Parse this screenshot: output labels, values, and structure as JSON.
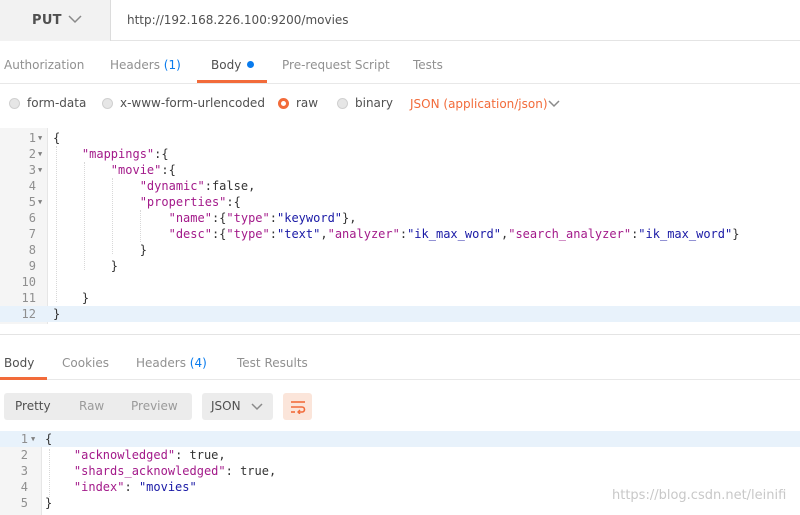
{
  "request": {
    "method": "PUT",
    "url": "http://192.168.226.100:9200/movies"
  },
  "request_tabs": [
    {
      "label": "Authorization"
    },
    {
      "label": "Headers",
      "count": "(1)"
    },
    {
      "label": "Body",
      "active": true
    },
    {
      "label": "Pre-request Script"
    },
    {
      "label": "Tests"
    }
  ],
  "body_options": {
    "form_data": "form-data",
    "urlencoded": "x-www-form-urlencoded",
    "raw": "raw",
    "binary": "binary",
    "selected": "raw",
    "content_type": "JSON (application/json)"
  },
  "request_body_lines": [
    "1",
    "2",
    "3",
    "4",
    "5",
    "6",
    "7",
    "8",
    "9",
    "10",
    "11",
    "12"
  ],
  "request_body": {
    "l1": "{",
    "l2_key": "\"mappings\"",
    "l2_rest": ":{",
    "l3_key": "\"movie\"",
    "l3_rest": ":{",
    "l4_key": "\"dynamic\"",
    "l4_rest": ":false,",
    "l5_key": "\"properties\"",
    "l5_rest": ":{",
    "l6_k1": "\"name\"",
    "l6_p1": ":{",
    "l6_k2": "\"type\"",
    "l6_p2": ":",
    "l6_v1": "\"keyword\"",
    "l6_p3": "},",
    "l7_k1": "\"desc\"",
    "l7_p1": ":{",
    "l7_k2": "\"type\"",
    "l7_p2": ":",
    "l7_v1": "\"text\"",
    "l7_p3": ",",
    "l7_k3": "\"analyzer\"",
    "l7_p4": ":",
    "l7_v2": "\"ik_max_word\"",
    "l7_p5": ",",
    "l7_k4": "\"search_analyzer\"",
    "l7_p6": ":",
    "l7_v3": "\"ik_max_word\"",
    "l7_p7": "}",
    "l8": "}",
    "l9": "}",
    "l10": "",
    "l11": "}",
    "l12": "}"
  },
  "response_tabs": [
    {
      "label": "Body",
      "active": true
    },
    {
      "label": "Cookies"
    },
    {
      "label": "Headers",
      "count": "(4)"
    },
    {
      "label": "Test Results"
    }
  ],
  "response_view": {
    "pretty": "Pretty",
    "raw": "Raw",
    "preview": "Preview",
    "selected": "Pretty",
    "format": "JSON",
    "wrap_icon": "wrap-lines-icon"
  },
  "response_body_lines": [
    "1",
    "2",
    "3",
    "4",
    "5"
  ],
  "response_body": {
    "l1": "{",
    "l2_key": "\"acknowledged\"",
    "l2_rest": ": true,",
    "l3_key": "\"shards_acknowledged\"",
    "l3_rest": ": true,",
    "l4_key": "\"index\"",
    "l4_p": ": ",
    "l4_val": "\"movies\"",
    "l5": "}"
  },
  "watermark": "https://blog.csdn.net/leinifi",
  "colors": {
    "accent": "#f26b3a",
    "blue": "#097bed",
    "json_key": "#a31a8a",
    "json_string": "#1a1aa6"
  }
}
